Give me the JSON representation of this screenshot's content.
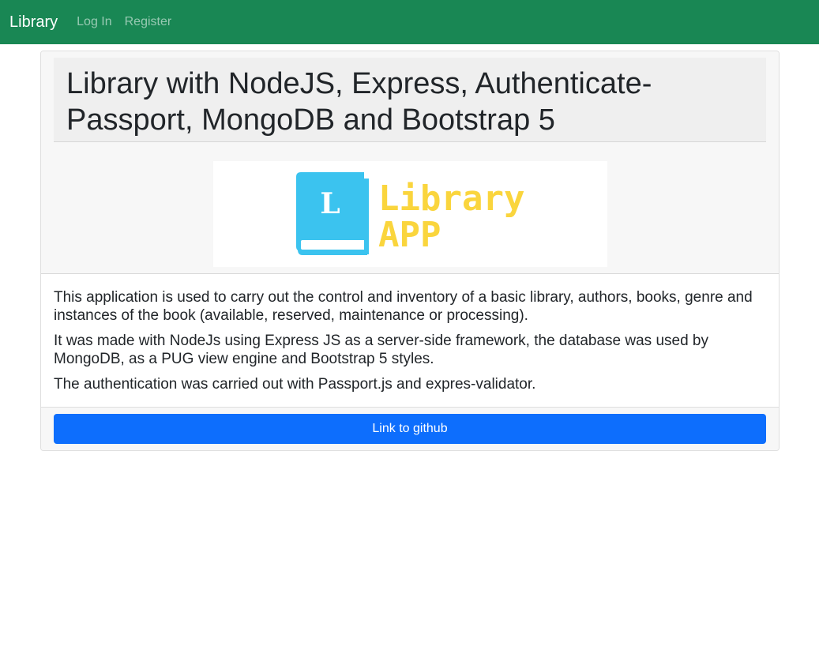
{
  "navbar": {
    "brand": "Library",
    "links": [
      {
        "label": "Log In"
      },
      {
        "label": "Register"
      }
    ],
    "color": "#198754"
  },
  "card": {
    "title": "Library with NodeJS, Express, Authenticate-Passport, MongoDB and Bootstrap 5",
    "logo": {
      "letter": "L",
      "line1": "Library",
      "line2": "APP",
      "book_color": "#3bc3ef",
      "text_color": "#fad53d"
    },
    "paragraphs": [
      "This application is used to carry out the control and inventory of a basic library, authors, books, genre and instances of the book (available, reserved, maintenance or processing).",
      "It was made with NodeJs using Express JS as a server-side framework, the database was used by MongoDB, as a PUG view engine and Bootstrap 5 styles.",
      "The authentication was carried out with Passport.js and expres-validator."
    ],
    "button_label": "Link to github",
    "button_color": "#0d6efd"
  }
}
